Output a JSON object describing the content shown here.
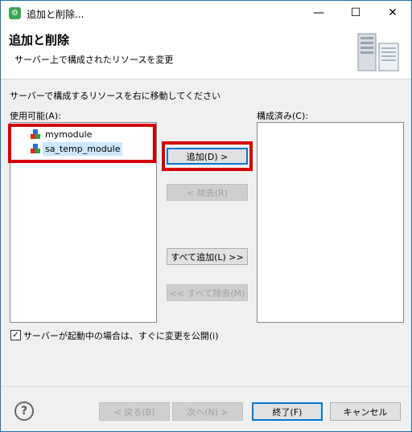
{
  "window": {
    "title": "追加と削除...",
    "controls": {
      "minimize": "—",
      "maximize": "☐",
      "close": "✕"
    },
    "icon": "eclipse-server-icon"
  },
  "header": {
    "title": "追加と削除",
    "subtitle": "サーバー上で構成されたリソースを変更",
    "image": "server-icon"
  },
  "instruction": "サーバーで構成するリソースを右に移動してください",
  "available": {
    "label": "使用可能(A):",
    "items": [
      {
        "label": "mymodule",
        "selected": false,
        "icon": "module-icon"
      },
      {
        "label": "sa_temp_module",
        "selected": true,
        "icon": "module-icon"
      }
    ]
  },
  "configured": {
    "label": "構成済み(C):",
    "items": []
  },
  "buttons": {
    "add": "追加(D) >",
    "remove": "< 除去(R)",
    "add_all": "すべて追加(L) >>",
    "remove_all": "<< すべて除去(M)"
  },
  "publish_option": {
    "label": "サーバーが起動中の場合は、すぐに変更を公開(i)",
    "checked": true
  },
  "footer": {
    "back": "< 戻る(B)",
    "next": "次へ(N) >",
    "finish": "終了(F)",
    "cancel": "キャンセル"
  },
  "colors": {
    "highlight": "#d40000",
    "selection": "#cce8ff",
    "accent": "#0078d7"
  }
}
